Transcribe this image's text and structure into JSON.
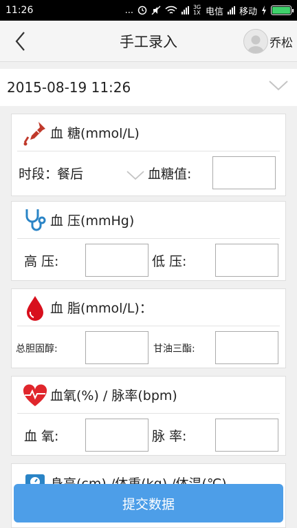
{
  "status_bar": {
    "time": "11:26",
    "dots": "...",
    "net_label": "3G 1X",
    "carrier1": "电信",
    "carrier2": "移动"
  },
  "header": {
    "title": "手工录入",
    "user_name": "乔松"
  },
  "date": {
    "value": "2015-08-19 11:26"
  },
  "blood_sugar": {
    "title": "血 糖(mmol/L)",
    "period_label": "时段：",
    "period_value": "餐后",
    "value_label": "血糖值:"
  },
  "blood_pressure": {
    "title": "血 压(mmHg)",
    "high_label": "高 压:",
    "low_label": "低 压:"
  },
  "blood_lipid": {
    "title": "血 脂(mmol/L)：",
    "cholesterol_label": "总胆固醇:",
    "triglyceride_label": "甘油三酯:"
  },
  "oxygen_pulse": {
    "title": "血氧(%) / 脉率(bpm)",
    "oxygen_label": "血 氧:",
    "pulse_label": "脉 率:"
  },
  "body": {
    "title": "身高(cm) /体重(kg) /体温(℃)"
  },
  "submit_label": "提交数据"
}
